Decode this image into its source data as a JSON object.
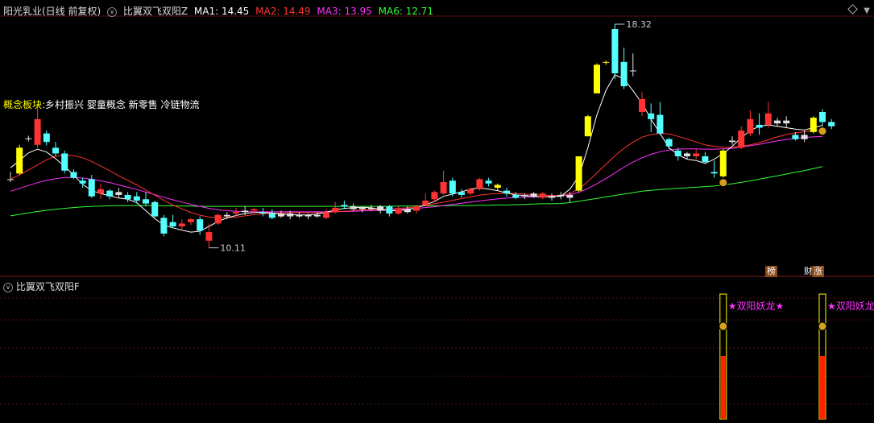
{
  "header": {
    "stock": "阳光乳业(日线 前复权)",
    "indicator": "比翼双飞双阳Z",
    "ma": [
      {
        "label": "MA1: 14.45",
        "color": "#ffffff"
      },
      {
        "label": "MA2: 14.49",
        "color": "#ff3333"
      },
      {
        "label": "MA3: 13.95",
        "color": "#ff33ff"
      },
      {
        "label": "MA6: 12.71",
        "color": "#33ff33"
      }
    ]
  },
  "concept": {
    "label": "概念板块:",
    "text": "乡村振兴 婴童概念 新零售 冷链物流"
  },
  "sub_header": "比翼双飞双阳F",
  "tags": {
    "bang": "榜",
    "cai": "财",
    "zhang": "涨"
  },
  "chart_data": {
    "type": "candlestick",
    "high_label": "18.32",
    "low_label": "10.11",
    "signal_label": "★双阳妖龙★",
    "signal_label_cut": "★双阳妖龙",
    "candles": [
      {
        "o": 12.9,
        "c": 12.9,
        "h": 13.15,
        "l": 12.8,
        "t": "x"
      },
      {
        "o": 13.1,
        "c": 14.0,
        "h": 14.1,
        "l": 13.05,
        "t": "y"
      },
      {
        "o": 14.33,
        "c": 14.3,
        "h": 14.42,
        "l": 14.22,
        "t": "x"
      },
      {
        "o": 15.0,
        "c": 14.1,
        "h": 15.55,
        "l": 14.0,
        "t": "r"
      },
      {
        "o": 14.5,
        "c": 14.2,
        "h": 14.6,
        "l": 14.08,
        "t": "c"
      },
      {
        "o": 14.0,
        "c": 13.8,
        "h": 14.2,
        "l": 13.7,
        "t": "c"
      },
      {
        "o": 13.8,
        "c": 13.2,
        "h": 13.9,
        "l": 13.1,
        "t": "c"
      },
      {
        "o": 13.15,
        "c": 12.95,
        "h": 13.25,
        "l": 12.9,
        "t": "c"
      },
      {
        "o": 12.85,
        "c": 12.75,
        "h": 12.95,
        "l": 12.6,
        "t": "c"
      },
      {
        "o": 12.9,
        "c": 12.3,
        "h": 13.05,
        "l": 12.25,
        "t": "c"
      },
      {
        "o": 12.4,
        "c": 12.55,
        "h": 12.75,
        "l": 12.2,
        "t": "r"
      },
      {
        "o": 12.5,
        "c": 12.3,
        "h": 12.55,
        "l": 12.2,
        "t": "c"
      },
      {
        "o": 12.45,
        "c": 12.35,
        "h": 12.6,
        "l": 12.25,
        "t": "x"
      },
      {
        "o": 12.35,
        "c": 12.2,
        "h": 12.45,
        "l": 12.1,
        "t": "c"
      },
      {
        "o": 12.3,
        "c": 12.15,
        "h": 12.45,
        "l": 12.05,
        "t": "c"
      },
      {
        "o": 12.2,
        "c": 12.05,
        "h": 12.45,
        "l": 11.95,
        "t": "c"
      },
      {
        "o": 12.1,
        "c": 11.6,
        "h": 12.15,
        "l": 11.55,
        "t": "c"
      },
      {
        "o": 11.55,
        "c": 11.0,
        "h": 11.65,
        "l": 10.9,
        "t": "c"
      },
      {
        "o": 11.4,
        "c": 11.25,
        "h": 11.65,
        "l": 11.2,
        "t": "c"
      },
      {
        "o": 11.25,
        "c": 11.35,
        "h": 11.5,
        "l": 11.15,
        "t": "r"
      },
      {
        "o": 11.4,
        "c": 11.5,
        "h": 11.55,
        "l": 11.3,
        "t": "r"
      },
      {
        "o": 11.5,
        "c": 11.1,
        "h": 11.6,
        "l": 10.95,
        "t": "c"
      },
      {
        "o": 10.75,
        "c": 11.05,
        "h": 11.35,
        "l": 10.5,
        "t": "r"
      },
      {
        "o": 11.35,
        "c": 11.65,
        "h": 11.7,
        "l": 11.3,
        "t": "r"
      },
      {
        "o": 11.6,
        "c": 11.65,
        "h": 11.75,
        "l": 11.5,
        "t": "x"
      },
      {
        "o": 11.7,
        "c": 11.75,
        "h": 11.9,
        "l": 11.6,
        "t": "r"
      },
      {
        "o": 11.8,
        "c": 11.75,
        "h": 11.95,
        "l": 11.65,
        "t": "x"
      },
      {
        "o": 11.8,
        "c": 11.85,
        "h": 11.9,
        "l": 11.7,
        "t": "r"
      },
      {
        "o": 11.75,
        "c": 11.7,
        "h": 11.9,
        "l": 11.6,
        "t": "c"
      },
      {
        "o": 11.7,
        "c": 11.55,
        "h": 11.85,
        "l": 11.5,
        "t": "c"
      },
      {
        "o": 11.6,
        "c": 11.7,
        "h": 11.8,
        "l": 11.55,
        "t": "x"
      },
      {
        "o": 11.7,
        "c": 11.6,
        "h": 11.8,
        "l": 11.5,
        "t": "x"
      },
      {
        "o": 11.6,
        "c": 11.65,
        "h": 11.75,
        "l": 11.55,
        "t": "x"
      },
      {
        "o": 11.65,
        "c": 11.6,
        "h": 11.7,
        "l": 11.5,
        "t": "x"
      },
      {
        "o": 11.6,
        "c": 11.65,
        "h": 11.75,
        "l": 11.55,
        "t": "x"
      },
      {
        "o": 11.55,
        "c": 11.75,
        "h": 11.85,
        "l": 11.5,
        "t": "r"
      },
      {
        "o": 11.75,
        "c": 11.9,
        "h": 12.1,
        "l": 11.7,
        "t": "r"
      },
      {
        "o": 11.95,
        "c": 12.0,
        "h": 12.15,
        "l": 11.85,
        "t": "c"
      },
      {
        "o": 11.95,
        "c": 11.85,
        "h": 12.05,
        "l": 11.8,
        "t": "x"
      },
      {
        "o": 11.85,
        "c": 11.9,
        "h": 11.95,
        "l": 11.75,
        "t": "x"
      },
      {
        "o": 11.9,
        "c": 11.85,
        "h": 12.0,
        "l": 11.8,
        "t": "x"
      },
      {
        "o": 11.8,
        "c": 11.95,
        "h": 12.0,
        "l": 11.7,
        "t": "x"
      },
      {
        "o": 11.95,
        "c": 11.7,
        "h": 12.0,
        "l": 11.6,
        "t": "c"
      },
      {
        "o": 11.7,
        "c": 11.85,
        "h": 11.95,
        "l": 11.65,
        "t": "r"
      },
      {
        "o": 11.85,
        "c": 11.75,
        "h": 11.95,
        "l": 11.7,
        "t": "x"
      },
      {
        "o": 11.8,
        "c": 11.95,
        "h": 12.0,
        "l": 11.7,
        "t": "r"
      },
      {
        "o": 12.0,
        "c": 12.15,
        "h": 12.4,
        "l": 11.95,
        "t": "r"
      },
      {
        "o": 12.2,
        "c": 12.45,
        "h": 12.5,
        "l": 12.1,
        "t": "r"
      },
      {
        "o": 12.4,
        "c": 12.8,
        "h": 13.2,
        "l": 12.35,
        "t": "r"
      },
      {
        "o": 12.85,
        "c": 12.4,
        "h": 12.95,
        "l": 12.3,
        "t": "c"
      },
      {
        "o": 12.45,
        "c": 12.35,
        "h": 12.55,
        "l": 12.25,
        "t": "c"
      },
      {
        "o": 12.4,
        "c": 12.55,
        "h": 12.6,
        "l": 12.35,
        "t": "r"
      },
      {
        "o": 12.55,
        "c": 12.9,
        "h": 12.95,
        "l": 12.5,
        "t": "r"
      },
      {
        "o": 12.85,
        "c": 12.75,
        "h": 12.95,
        "l": 12.65,
        "t": "c"
      },
      {
        "o": 12.7,
        "c": 12.6,
        "h": 12.75,
        "l": 12.5,
        "t": "y"
      },
      {
        "o": 12.5,
        "c": 12.4,
        "h": 12.6,
        "l": 12.3,
        "t": "c"
      },
      {
        "o": 12.35,
        "c": 12.25,
        "h": 12.45,
        "l": 12.2,
        "t": "c"
      },
      {
        "o": 12.3,
        "c": 12.35,
        "h": 12.4,
        "l": 12.2,
        "t": "x"
      },
      {
        "o": 12.3,
        "c": 12.4,
        "h": 12.45,
        "l": 12.25,
        "t": "x"
      },
      {
        "o": 12.4,
        "c": 12.25,
        "h": 12.45,
        "l": 12.2,
        "t": "r"
      },
      {
        "o": 12.25,
        "c": 12.3,
        "h": 12.4,
        "l": 12.15,
        "t": "x"
      },
      {
        "o": 12.3,
        "c": 12.35,
        "h": 12.45,
        "l": 12.2,
        "t": "x"
      },
      {
        "o": 12.35,
        "c": 12.25,
        "h": 12.45,
        "l": 12.1,
        "t": "x"
      },
      {
        "o": 12.5,
        "c": 13.7,
        "h": 13.7,
        "l": 12.45,
        "t": "y"
      },
      {
        "o": 14.4,
        "c": 15.1,
        "h": 15.15,
        "l": 14.4,
        "t": "y"
      },
      {
        "o": 15.9,
        "c": 16.9,
        "h": 16.95,
        "l": 15.9,
        "t": "y"
      },
      {
        "o": 17.0,
        "c": 17.0,
        "h": 17.05,
        "l": 16.9,
        "t": "y"
      },
      {
        "o": 16.6,
        "c": 18.15,
        "h": 18.32,
        "l": 16.4,
        "t": "c"
      },
      {
        "o": 17.0,
        "c": 16.15,
        "h": 17.5,
        "l": 16.05,
        "t": "c"
      },
      {
        "o": 16.7,
        "c": 16.7,
        "h": 17.3,
        "l": 16.5,
        "t": "x"
      },
      {
        "o": 15.7,
        "c": 15.25,
        "h": 15.95,
        "l": 15.1,
        "t": "r"
      },
      {
        "o": 15.2,
        "c": 15.0,
        "h": 15.55,
        "l": 14.55,
        "t": "c"
      },
      {
        "o": 15.15,
        "c": 14.5,
        "h": 15.6,
        "l": 14.45,
        "t": "c"
      },
      {
        "o": 14.3,
        "c": 14.05,
        "h": 14.35,
        "l": 13.95,
        "t": "c"
      },
      {
        "o": 13.9,
        "c": 13.7,
        "h": 14.0,
        "l": 13.55,
        "t": "c"
      },
      {
        "o": 13.7,
        "c": 13.8,
        "h": 13.85,
        "l": 13.6,
        "t": "x"
      },
      {
        "o": 13.7,
        "c": 13.8,
        "h": 13.95,
        "l": 13.6,
        "t": "r"
      },
      {
        "o": 13.7,
        "c": 13.5,
        "h": 13.85,
        "l": 13.45,
        "t": "c"
      },
      {
        "o": 13.15,
        "c": 13.1,
        "h": 13.55,
        "l": 12.95,
        "t": "c"
      },
      {
        "o": 13.0,
        "c": 13.9,
        "h": 13.95,
        "l": 12.95,
        "t": "y"
      },
      {
        "o": 14.25,
        "c": 14.2,
        "h": 14.4,
        "l": 14.1,
        "t": "x"
      },
      {
        "o": 14.0,
        "c": 14.6,
        "h": 14.75,
        "l": 13.95,
        "t": "r"
      },
      {
        "o": 14.5,
        "c": 15.0,
        "h": 15.3,
        "l": 14.4,
        "t": "r"
      },
      {
        "o": 14.7,
        "c": 14.8,
        "h": 15.2,
        "l": 14.45,
        "t": "c"
      },
      {
        "o": 14.8,
        "c": 15.2,
        "h": 15.6,
        "l": 14.7,
        "t": "r"
      },
      {
        "o": 14.95,
        "c": 14.85,
        "h": 15.05,
        "l": 14.75,
        "t": "x"
      },
      {
        "o": 14.95,
        "c": 14.85,
        "h": 15.1,
        "l": 14.7,
        "t": "x"
      },
      {
        "o": 14.45,
        "c": 14.3,
        "h": 14.55,
        "l": 14.25,
        "t": "c"
      },
      {
        "o": 14.3,
        "c": 14.45,
        "h": 14.6,
        "l": 14.2,
        "t": "x"
      },
      {
        "o": 14.55,
        "c": 15.05,
        "h": 15.1,
        "l": 14.5,
        "t": "y"
      },
      {
        "o": 15.25,
        "c": 14.9,
        "h": 15.35,
        "l": 14.75,
        "t": "c"
      },
      {
        "o": 14.9,
        "c": 14.75,
        "h": 15.0,
        "l": 14.65,
        "t": "c"
      }
    ],
    "ma1": [
      13.3,
      13.55,
      13.82,
      13.95,
      13.85,
      13.62,
      13.35,
      13.05,
      12.72,
      12.5,
      12.4,
      12.32,
      12.24,
      12.2,
      12.08,
      11.8,
      11.52,
      11.3,
      11.2,
      11.12,
      11.05,
      11.08,
      11.25,
      11.42,
      11.55,
      11.63,
      11.7,
      11.74,
      11.74,
      11.72,
      11.68,
      11.66,
      11.65,
      11.65,
      11.68,
      11.75,
      11.82,
      11.88,
      11.9,
      11.92,
      11.9,
      11.84,
      11.8,
      11.8,
      11.84,
      11.9,
      12.0,
      12.12,
      12.3,
      12.38,
      12.46,
      12.55,
      12.6,
      12.55,
      12.5,
      12.42,
      12.35,
      12.33,
      12.3,
      12.28,
      12.3,
      12.3,
      12.55,
      13.0,
      14.0,
      15.15,
      16.0,
      16.55,
      16.4,
      16.0,
      15.55,
      15.0,
      14.5,
      14.0,
      13.75,
      13.6,
      13.55,
      13.45,
      13.6,
      13.8,
      14.05,
      14.35,
      14.6,
      14.75,
      14.8,
      14.75,
      14.7,
      14.65,
      14.62,
      14.7,
      14.78
    ],
    "ma2": [
      12.9,
      13.05,
      13.22,
      13.4,
      13.58,
      13.7,
      13.75,
      13.72,
      13.65,
      13.52,
      13.36,
      13.2,
      13.02,
      12.86,
      12.7,
      12.52,
      12.34,
      12.16,
      12.0,
      11.86,
      11.74,
      11.64,
      11.58,
      11.55,
      11.55,
      11.57,
      11.62,
      11.66,
      11.69,
      11.71,
      11.72,
      11.73,
      11.73,
      11.73,
      11.73,
      11.74,
      11.76,
      11.78,
      11.8,
      11.82,
      11.84,
      11.85,
      11.86,
      11.88,
      11.9,
      11.94,
      11.98,
      12.04,
      12.1,
      12.16,
      12.22,
      12.28,
      12.34,
      12.38,
      12.4,
      12.41,
      12.4,
      12.38,
      12.36,
      12.34,
      12.33,
      12.33,
      12.4,
      12.56,
      12.82,
      13.12,
      13.42,
      13.72,
      13.98,
      14.2,
      14.37,
      14.46,
      14.5,
      14.48,
      14.4,
      14.3,
      14.2,
      14.1,
      14.05,
      14.02,
      14.02,
      14.05,
      14.1,
      14.18,
      14.28,
      14.38,
      14.46,
      14.52,
      14.55,
      14.6,
      14.63
    ],
    "ma3": [
      12.48,
      12.58,
      12.68,
      12.78,
      12.86,
      12.92,
      12.96,
      12.96,
      12.94,
      12.9,
      12.84,
      12.78,
      12.7,
      12.62,
      12.54,
      12.45,
      12.36,
      12.27,
      12.18,
      12.1,
      12.02,
      11.95,
      11.88,
      11.83,
      11.8,
      11.78,
      11.77,
      11.76,
      11.76,
      11.76,
      11.76,
      11.76,
      11.76,
      11.76,
      11.76,
      11.76,
      11.76,
      11.77,
      11.78,
      11.79,
      11.8,
      11.81,
      11.82,
      11.84,
      11.86,
      11.88,
      11.91,
      11.94,
      11.98,
      12.02,
      12.06,
      12.1,
      12.14,
      12.18,
      12.21,
      12.24,
      12.26,
      12.27,
      12.28,
      12.29,
      12.3,
      12.31,
      12.35,
      12.44,
      12.57,
      12.74,
      12.92,
      13.12,
      13.32,
      13.5,
      13.65,
      13.77,
      13.86,
      13.92,
      13.95,
      13.96,
      13.96,
      13.95,
      13.95,
      13.96,
      13.98,
      14.02,
      14.07,
      14.12,
      14.18,
      14.24,
      14.29,
      14.33,
      14.36,
      14.38,
      14.4
    ],
    "ma6": [
      11.62,
      11.67,
      11.72,
      11.77,
      11.81,
      11.85,
      11.88,
      11.91,
      11.93,
      11.95,
      11.96,
      11.97,
      11.98,
      11.98,
      11.98,
      11.98,
      11.98,
      11.97,
      11.97,
      11.96,
      11.96,
      11.95,
      11.95,
      11.95,
      11.95,
      11.95,
      11.95,
      11.95,
      11.95,
      11.95,
      11.95,
      11.95,
      11.95,
      11.95,
      11.95,
      11.95,
      11.95,
      11.95,
      11.95,
      11.95,
      11.95,
      11.95,
      11.95,
      11.96,
      11.96,
      11.96,
      11.97,
      11.97,
      11.97,
      11.98,
      11.98,
      11.98,
      11.99,
      11.99,
      12.0,
      12.0,
      12.01,
      12.02,
      12.03,
      12.04,
      12.04,
      12.05,
      12.08,
      12.13,
      12.18,
      12.23,
      12.28,
      12.33,
      12.38,
      12.43,
      12.48,
      12.51,
      12.54,
      12.56,
      12.58,
      12.6,
      12.62,
      12.64,
      12.66,
      12.7,
      12.74,
      12.79,
      12.84,
      12.9,
      12.96,
      13.02,
      13.08,
      13.14,
      13.2,
      13.27,
      13.34
    ],
    "signals": [
      79,
      90
    ],
    "colors": {
      "up": "#ff3333",
      "down": "#54ffff",
      "doji": "#e0e0e0",
      "yellow": "#ffff00",
      "ma1": "#ffffff",
      "ma2": "#ff3333",
      "ma3": "#ff33ff",
      "ma6": "#33ff33",
      "signal_text": "#ff33ff"
    }
  }
}
